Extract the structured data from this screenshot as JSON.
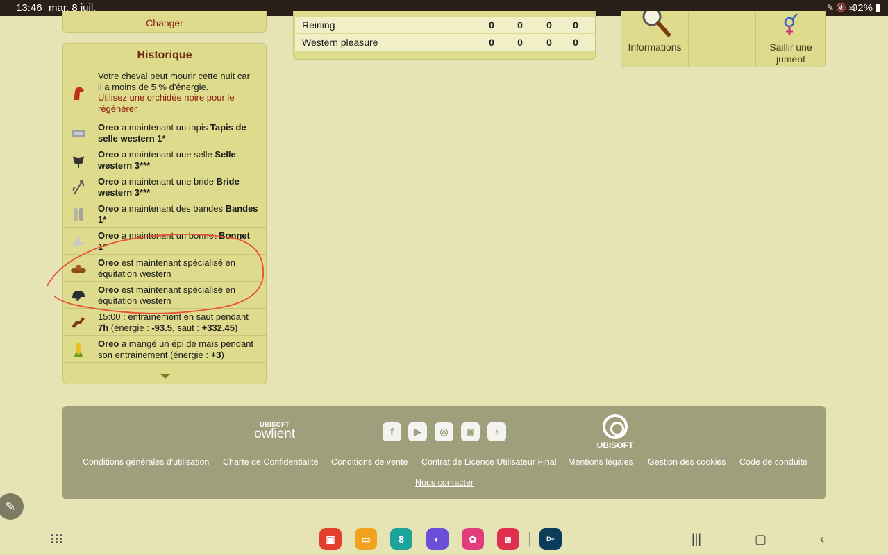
{
  "status_bar": {
    "time": "13:46",
    "date": "mar. 8 juil.",
    "battery": "92%",
    "icons": [
      "pen-icon",
      "mute-icon",
      "wifi-icon"
    ]
  },
  "top_left": {
    "changer_label": "Changer"
  },
  "stats": {
    "rows": [
      {
        "name": "Reining",
        "values": [
          "0",
          "0",
          "0",
          "0"
        ]
      },
      {
        "name": "Western pleasure",
        "values": [
          "0",
          "0",
          "0",
          "0"
        ]
      }
    ]
  },
  "actions": {
    "informations_label": "Informations",
    "saillir_label_1": "Saillir une",
    "saillir_label_2": "jument"
  },
  "historique": {
    "title": "Historique",
    "items": [
      {
        "icon": "horse-head-icon",
        "text1": "Votre cheval peut mourir cette nuit car",
        "text2": "il a moins de 5 % d'énergie.",
        "red1": "Utilisez une orchidée noire pour le",
        "red2": "régénérer"
      },
      {
        "icon": "saddle-pad-icon",
        "bold1": "Oreo",
        "rest1": " a maintenant un tapis ",
        "bold2": "Tapis de",
        "line2": "selle western 1*"
      },
      {
        "icon": "saddle-icon",
        "bold1": "Oreo",
        "rest1": " a maintenant une selle ",
        "bold2": "Selle",
        "line2": "western 3***"
      },
      {
        "icon": "bridle-icon",
        "bold1": "Oreo",
        "rest1": " a maintenant une bride ",
        "bold2": "Bride",
        "line2": "western 3***"
      },
      {
        "icon": "bandages-icon",
        "bold1": "Oreo",
        "rest1": " a maintenant des bandes ",
        "bold2": "Bandes",
        "line2": "1*"
      },
      {
        "icon": "bonnet-icon",
        "bold1": "Oreo",
        "rest1": " a maintenant un bonnet ",
        "bold2": "Bonnet",
        "line2": "1*"
      },
      {
        "icon": "cowboy-hat-icon",
        "bold1": "Oreo",
        "rest1": " est maintenant spécialisé en",
        "line2": "équitation western"
      },
      {
        "icon": "riding-helmet-icon",
        "bold1": "Oreo",
        "rest1": " est maintenant spécialisé en",
        "line2": "équitation western"
      },
      {
        "icon": "jumping-horse-icon",
        "line1": "15:00 : entraînement en saut pendant",
        "b_time": "7h",
        "mid1": " (énergie : ",
        "b_energy": "-93.5",
        "mid2": ", saut : ",
        "b_saut": "+332.45",
        "end": ")"
      },
      {
        "icon": "corn-icon",
        "bold1": "Oreo",
        "rest1": " a mangé un épi de maïs pendant",
        "line2a": "son entrainement (énergie : ",
        "b_val": "+3",
        "line2b": ")"
      }
    ]
  },
  "footer": {
    "owlient_small": "UBISOFT",
    "owlient_big": "owlient",
    "ubisoft_word": "UBISOFT",
    "social_icons": [
      "facebook-icon",
      "youtube-icon",
      "instagram-icon",
      "discord-icon",
      "tiktok-icon"
    ],
    "links": [
      "Conditions générales d'utilisation",
      "Charte de Confidentialité",
      "Conditions de vente",
      "Contrat de Licence Utilisateur Final",
      "Mentions légales",
      "Gestion des cookies",
      "Code de conduite"
    ],
    "contact": "Nous contacter"
  },
  "navbar": {
    "calendar_day": "8",
    "apps": [
      "notes-app-icon",
      "files-app-icon",
      "calendar-app-icon",
      "browser-app-icon",
      "gallery-app-icon",
      "camera-app-icon",
      "disney-plus-app-icon"
    ]
  },
  "colors": {
    "page_bg": "#e6e3b5",
    "panel": "#dedb8c",
    "footer": "#a09f7b",
    "annotation": "#e8503a"
  }
}
